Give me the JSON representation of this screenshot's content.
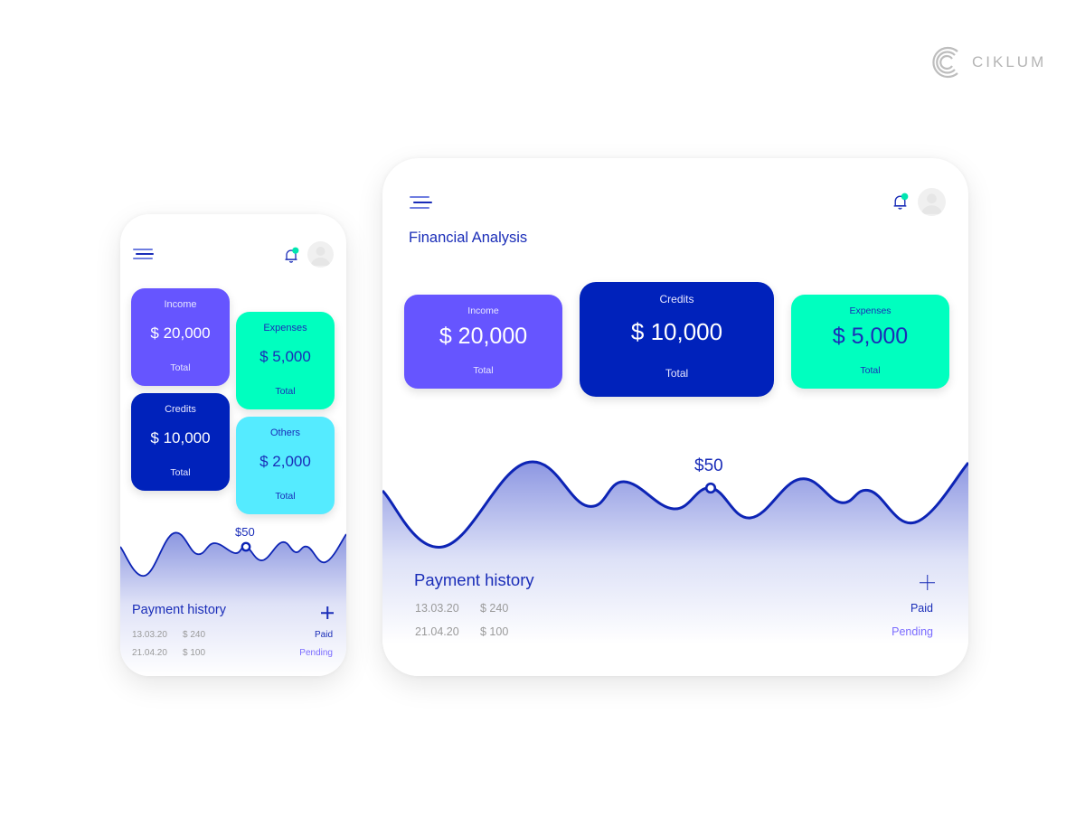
{
  "brand": {
    "name": "CIKLUM",
    "logo_icon": "ciklum-logo-icon"
  },
  "colors": {
    "income": "#6655FF",
    "credits": "#0022BB",
    "expenses": "#00FFBF",
    "others": "#55EBFF",
    "primary_text": "#1A2DB8",
    "notification_dot": "#00E6B0",
    "pending": "#7A6BFF",
    "muted_text": "#9A9A9A"
  },
  "phone": {
    "header": {
      "menu_icon": "hamburger-menu-icon",
      "notification_icon": "bell-icon",
      "avatar_icon": "user-avatar-icon"
    },
    "cards": [
      {
        "id": "income",
        "label": "Income",
        "value": "$ 20,000",
        "footer": "Total"
      },
      {
        "id": "expenses",
        "label": "Expenses",
        "value": "$ 5,000",
        "footer": "Total"
      },
      {
        "id": "credits",
        "label": "Credits",
        "value": "$ 10,000",
        "footer": "Total"
      },
      {
        "id": "others",
        "label": "Others",
        "value": "$ 2,000",
        "footer": "Total"
      }
    ],
    "chart": {
      "highlight_label": "$50"
    },
    "payment_history": {
      "title": "Payment history",
      "add_icon": "plus-icon",
      "rows": [
        {
          "date": "13.03.20",
          "amount": "$ 240",
          "status": "Paid"
        },
        {
          "date": "21.04.20",
          "amount": "$ 100",
          "status": "Pending"
        }
      ]
    }
  },
  "tablet": {
    "header": {
      "menu_icon": "hamburger-menu-icon",
      "notification_icon": "bell-icon",
      "avatar_icon": "user-avatar-icon"
    },
    "title": "Financial Analysis",
    "cards": [
      {
        "id": "income",
        "label": "Income",
        "value": "$ 20,000",
        "footer": "Total"
      },
      {
        "id": "credits",
        "label": "Credits",
        "value": "$ 10,000",
        "footer": "Total"
      },
      {
        "id": "expenses",
        "label": "Expenses",
        "value": "$ 5,000",
        "footer": "Total"
      }
    ],
    "chart": {
      "highlight_label": "$50"
    },
    "payment_history": {
      "title": "Payment history",
      "add_icon": "plus-icon",
      "rows": [
        {
          "date": "13.03.20",
          "amount": "$ 240",
          "status": "Paid"
        },
        {
          "date": "21.04.20",
          "amount": "$ 100",
          "status": "Pending"
        }
      ]
    }
  }
}
